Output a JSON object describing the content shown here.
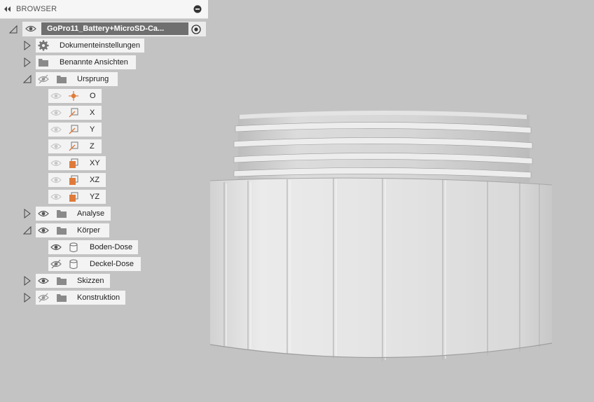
{
  "browser": {
    "title": "BROWSER",
    "root": {
      "label": "GoPro11_Battery+MicroSD-Ca..."
    },
    "items": {
      "settings": "Dokumenteinstellungen",
      "named_views": "Benannte Ansichten",
      "origin": "Ursprung",
      "origin_o": "O",
      "origin_x": "X",
      "origin_y": "Y",
      "origin_z": "Z",
      "origin_xy": "XY",
      "origin_xz": "XZ",
      "origin_yz": "YZ",
      "analysis": "Analyse",
      "bodies": "Körper",
      "body1": "Boden-Dose",
      "body2": "Deckel-Dose",
      "sketches": "Skizzen",
      "construction": "Konstruktion"
    }
  },
  "colors": {
    "background": "#c3c3c3",
    "panel": "#f3f3f3",
    "root_highlight": "#6f6f6f",
    "origin_accent": "#e07a3a",
    "model": "#e8e8e8"
  },
  "icons": {
    "collapse": "double-chevron-left-icon",
    "close_panel": "minus-circle-icon",
    "visible": "eye-icon",
    "hidden": "eye-slash-icon",
    "folder": "folder-icon",
    "settings": "gear-icon",
    "component": "component-icon",
    "body": "body-cylinder-icon",
    "origin_point": "origin-point-icon",
    "axis": "axis-icon",
    "plane": "plane-icon",
    "activate": "radio-target-icon"
  }
}
